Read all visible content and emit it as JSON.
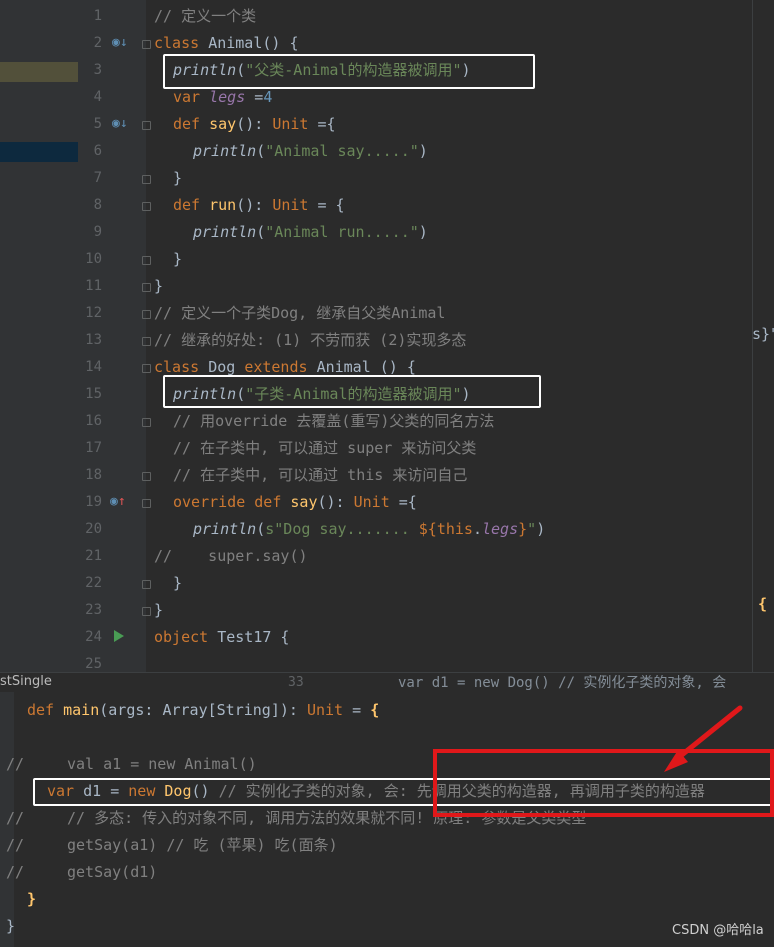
{
  "top_editor": {
    "lines": [
      {
        "n": "1",
        "t": "// 定义一个类"
      },
      {
        "n": "2",
        "t": "class Animal() {"
      },
      {
        "n": "3",
        "t": "println(\"父类-Animal的构造器被调用\")"
      },
      {
        "n": "4",
        "t": "var legs =4"
      },
      {
        "n": "5",
        "t": "def say(): Unit ={"
      },
      {
        "n": "6",
        "t": "println(\"Animal say.....\")"
      },
      {
        "n": "7",
        "t": "}"
      },
      {
        "n": "8",
        "t": "def run(): Unit = {"
      },
      {
        "n": "9",
        "t": "println(\"Animal run.....\")"
      },
      {
        "n": "10",
        "t": "}"
      },
      {
        "n": "11",
        "t": "}"
      },
      {
        "n": "12",
        "t": "// 定义一个子类Dog, 继承自父类Animal"
      },
      {
        "n": "13",
        "t": "// 继承的好处: (1) 不劳而获 (2)实现多态"
      },
      {
        "n": "14",
        "t": "class Dog extends Animal () {"
      },
      {
        "n": "15",
        "t": "println(\"子类-Animal的构造器被调用\")"
      },
      {
        "n": "16",
        "t": "// 用override 去覆盖(重写)父类的同名方法"
      },
      {
        "n": "17",
        "t": "// 在子类中, 可以通过 super 来访问父类"
      },
      {
        "n": "18",
        "t": "// 在子类中, 可以通过 this 来访问自己"
      },
      {
        "n": "19",
        "t": "override def say(): Unit ={"
      },
      {
        "n": "20",
        "t": "println(s\"Dog say....... ${this.legs}\")"
      },
      {
        "n": "21",
        "t": "//    super.say()"
      },
      {
        "n": "22",
        "t": "}"
      },
      {
        "n": "23",
        "t": "}"
      },
      {
        "n": "24",
        "t": "object Test17 {"
      },
      {
        "n": "25",
        "t": ""
      }
    ]
  },
  "right_peek": {
    "line3": "s}\"",
    "line24": "{"
  },
  "tab_label": "stSingle",
  "behind_snippet": {
    "num": "33",
    "text": "var d1 = new Dog() // 实例化子类的对象, 会"
  },
  "bottom_editor": {
    "lines": [
      "def main(args: Array[String]): Unit = {",
      "val a1 = new Animal()",
      "var d1 = new Dog() // 实例化子类的对象, 会: 先调用父类的构造器, 再调用子类的构造器",
      "// 多态: 传入的对象不同, 调用方法的效果就不同! 原理: 参数是父类类型",
      "getSay(a1) // 吃 (苹果) 吃(面条)",
      "getSay(d1)",
      "}"
    ]
  },
  "watermark": "CSDN @哈哈la",
  "colors": {
    "background": "#2b2b2b",
    "keyword": "#cc7832",
    "string": "#6a8759",
    "comment": "#808080",
    "highlight_box": "#ffffff",
    "arrow": "#e0181a"
  }
}
